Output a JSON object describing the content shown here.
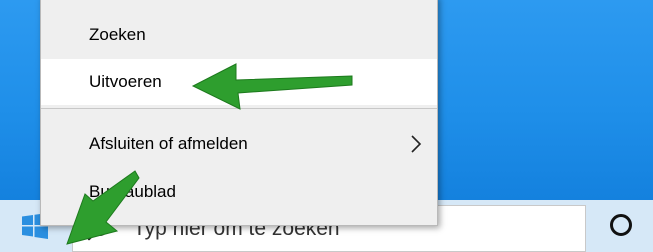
{
  "context_menu": {
    "items": [
      {
        "label": "Zoeken",
        "highlighted": false,
        "has_submenu": false
      },
      {
        "label": "Uitvoeren",
        "highlighted": true,
        "has_submenu": false
      },
      {
        "label": "Afsluiten of afmelden",
        "highlighted": false,
        "has_submenu": true
      },
      {
        "label": "Bureaublad",
        "highlighted": false,
        "has_submenu": false
      }
    ]
  },
  "taskbar": {
    "start_icon": "windows-logo-icon",
    "search": {
      "placeholder": "Typ hier om te zoeken",
      "icon": "search-icon"
    },
    "cortana_icon": "cortana-circle-icon"
  },
  "annotations": {
    "arrow_color": "#2e9e2e",
    "arrows": [
      "green-arrow-pointing-to-uitvoeren",
      "green-arrow-pointing-to-start"
    ]
  },
  "colors": {
    "desktop_blue": "#1f8fe9",
    "taskbar": "#d6e8f7",
    "menu_bg": "#efefef",
    "menu_highlight": "#ffffff",
    "windows_logo": "#2b8fe0"
  }
}
